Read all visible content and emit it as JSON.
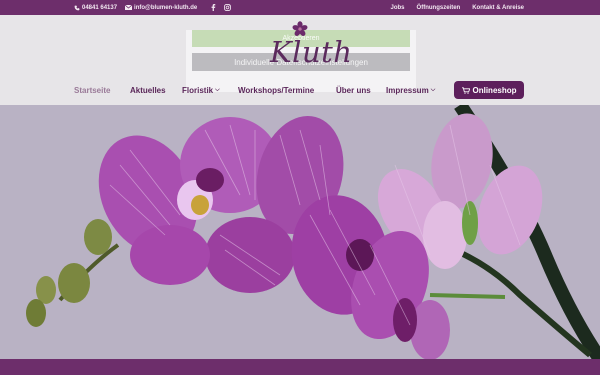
{
  "topbar": {
    "phone": "04841 64137",
    "email": "info@blumen-kluth.de",
    "social": [
      "facebook-icon",
      "instagram-icon"
    ],
    "links": [
      "Jobs",
      "Öffnungszeiten",
      "Kontakt & Anreise"
    ]
  },
  "logo": {
    "text": "Kluth"
  },
  "popup": {
    "accept_label": "Akzeptieren",
    "settings_label": "Individuelle Datenschutzeinstellungen"
  },
  "nav": {
    "items": [
      {
        "label": "Startseite",
        "active": true,
        "dropdown": false
      },
      {
        "label": "Aktuelles",
        "active": false,
        "dropdown": false
      },
      {
        "label": "Floristik",
        "active": false,
        "dropdown": true
      },
      {
        "label": "Workshops/Termine",
        "active": false,
        "dropdown": false
      },
      {
        "label": "Über uns",
        "active": false,
        "dropdown": false
      },
      {
        "label": "Impressum",
        "active": false,
        "dropdown": true
      }
    ],
    "shop_label": "Onlineshop"
  },
  "colors": {
    "brand": "#6d2e6b",
    "nav_text": "#5a2659",
    "shop_button": "#5d1f5c",
    "hero_bg": "#b9b2c4"
  },
  "hero": {
    "subject": "purple-orchid-image"
  }
}
